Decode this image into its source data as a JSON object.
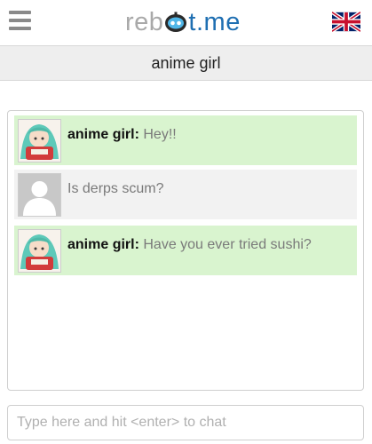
{
  "header": {
    "logo_part1": "reb",
    "logo_part2": "t.me",
    "language_icon": "uk-flag-icon",
    "menu_icon": "hamburger-menu-icon"
  },
  "chat": {
    "title": "anime girl"
  },
  "messages": [
    {
      "type": "bot",
      "name": "anime girl:",
      "text": "Hey!!",
      "avatar": "anime-girl-avatar"
    },
    {
      "type": "user",
      "name": "",
      "text": "Is derps scum?",
      "avatar": "default-user-avatar"
    },
    {
      "type": "bot",
      "name": "anime girl:",
      "text": "Have you ever tried sushi?",
      "avatar": "anime-girl-avatar"
    }
  ],
  "input": {
    "placeholder": "Type here and hit <enter> to chat",
    "value": ""
  },
  "colors": {
    "logo_gray": "#a9a9a9",
    "logo_blue": "#1f6fb2",
    "bot_bubble": "#d9f4cf",
    "user_bubble": "#f2f2f2"
  }
}
